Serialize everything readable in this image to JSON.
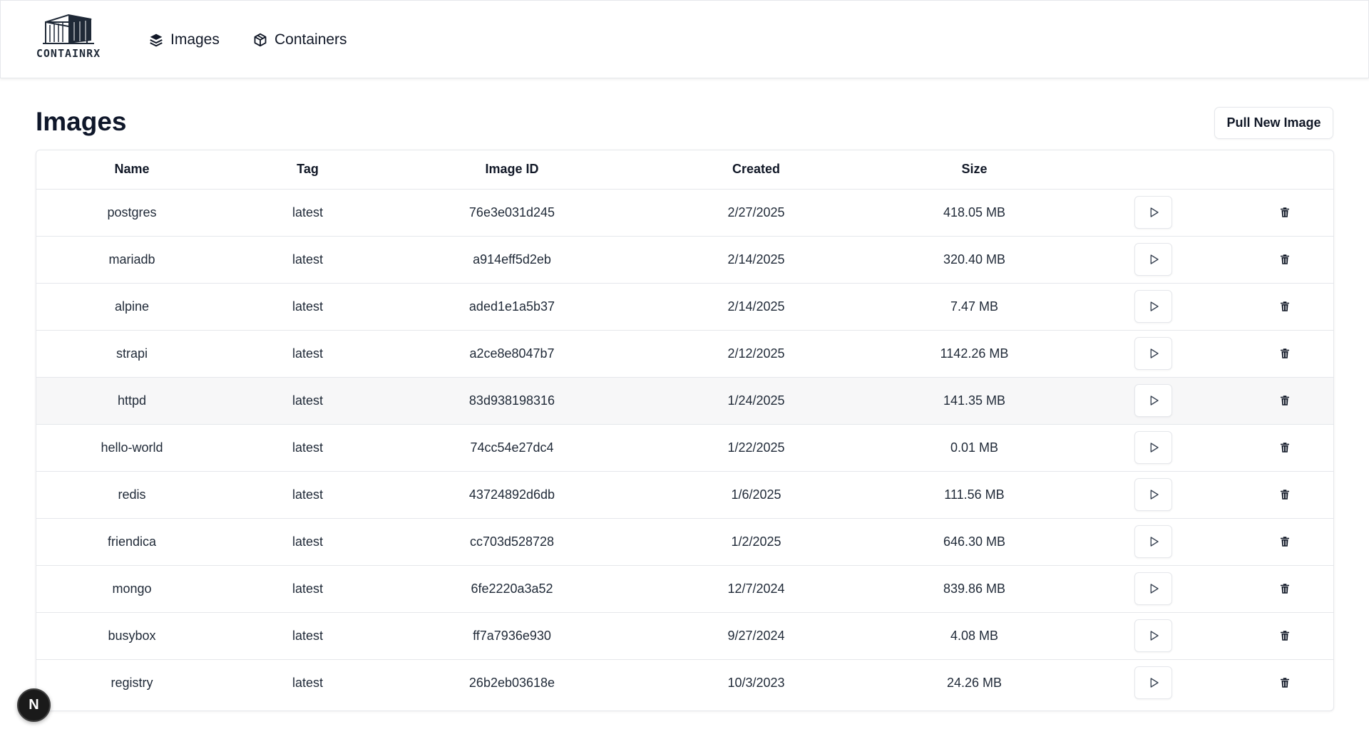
{
  "navbar": {
    "logo_text": "CONTAINRX",
    "links": [
      {
        "label": "Images",
        "icon": "layers-icon"
      },
      {
        "label": "Containers",
        "icon": "box-icon"
      }
    ]
  },
  "page": {
    "title": "Images",
    "pull_button_label": "Pull New Image"
  },
  "table": {
    "columns": [
      "Name",
      "Tag",
      "Image ID",
      "Created",
      "Size"
    ],
    "rows": [
      {
        "name": "postgres",
        "tag": "latest",
        "image_id": "76e3e031d245",
        "created": "2/27/2025",
        "size": "418.05 MB"
      },
      {
        "name": "mariadb",
        "tag": "latest",
        "image_id": "a914eff5d2eb",
        "created": "2/14/2025",
        "size": "320.40 MB"
      },
      {
        "name": "alpine",
        "tag": "latest",
        "image_id": "aded1e1a5b37",
        "created": "2/14/2025",
        "size": "7.47 MB"
      },
      {
        "name": "strapi",
        "tag": "latest",
        "image_id": "a2ce8e8047b7",
        "created": "2/12/2025",
        "size": "1142.26 MB"
      },
      {
        "name": "httpd",
        "tag": "latest",
        "image_id": "83d938198316",
        "created": "1/24/2025",
        "size": "141.35 MB"
      },
      {
        "name": "hello-world",
        "tag": "latest",
        "image_id": "74cc54e27dc4",
        "created": "1/22/2025",
        "size": "0.01 MB"
      },
      {
        "name": "redis",
        "tag": "latest",
        "image_id": "43724892d6db",
        "created": "1/6/2025",
        "size": "111.56 MB"
      },
      {
        "name": "friendica",
        "tag": "latest",
        "image_id": "cc703d528728",
        "created": "1/2/2025",
        "size": "646.30 MB"
      },
      {
        "name": "mongo",
        "tag": "latest",
        "image_id": "6fe2220a3a52",
        "created": "12/7/2024",
        "size": "839.86 MB"
      },
      {
        "name": "busybox",
        "tag": "latest",
        "image_id": "ff7a7936e930",
        "created": "9/27/2024",
        "size": "4.08 MB"
      },
      {
        "name": "registry",
        "tag": "latest",
        "image_id": "26b2eb03618e",
        "created": "10/3/2023",
        "size": "24.26 MB"
      }
    ],
    "row_actions": {
      "run_icon": "play-icon",
      "delete_icon": "trash-icon"
    }
  },
  "dev_badge": {
    "label": "N"
  },
  "colors": {
    "text": "#111827",
    "border": "#e5e7eb",
    "highlight_row": "#f7f7f8",
    "badge_bg": "#1a1a1a"
  }
}
